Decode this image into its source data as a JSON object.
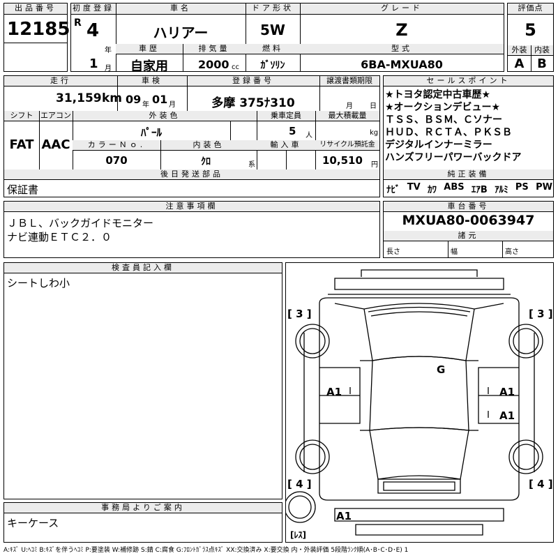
{
  "lot": {
    "header": "出品番号",
    "value": "12185"
  },
  "first_reg": {
    "header": "初度登録",
    "era": "R",
    "year": "4",
    "year_unit": "年",
    "month": "1",
    "month_unit": "月"
  },
  "car_name": {
    "header": "車名",
    "value": "ハリアー"
  },
  "door": {
    "header": "ドア形状",
    "value": "5W"
  },
  "grade": {
    "header": "グレード",
    "value": "Z"
  },
  "score": {
    "header": "評価点",
    "value": "5",
    "ext_header": "外装",
    "ext_value": "A",
    "int_header": "内装",
    "int_value": "B"
  },
  "history": {
    "header": "車歴",
    "value": "自家用"
  },
  "displacement": {
    "header": "排気量",
    "value": "2000",
    "unit": "cc"
  },
  "fuel": {
    "header": "燃料",
    "value": "ｶﾞｿﾘﾝ"
  },
  "model": {
    "header": "型式",
    "value": "6BA-MXUA80"
  },
  "mileage": {
    "header": "走行",
    "value": "31,159",
    "unit": "km"
  },
  "inspection": {
    "header": "車検",
    "year": "09",
    "year_unit": "年",
    "month": "01",
    "month_unit": "月"
  },
  "plate": {
    "header": "登録番号",
    "value": "多摩 375ﾅ310"
  },
  "transfer": {
    "header": "譲渡書類期限",
    "month_unit": "月",
    "day_unit": "日"
  },
  "shift": {
    "header": "シフト",
    "value": "FAT"
  },
  "aircon": {
    "header": "エアコン",
    "value": "AAC"
  },
  "exterior_color": {
    "header": "外装色",
    "value": "ﾊﾟｰﾙ"
  },
  "capacity": {
    "header": "乗車定員",
    "value": "5",
    "unit": "人"
  },
  "max_load": {
    "header": "最大積載量",
    "unit": "kg"
  },
  "color_no": {
    "header": "カラーＮｏ.",
    "value": "070"
  },
  "interior_color": {
    "header": "内装色",
    "value": "ｸﾛ",
    "unit": "系"
  },
  "import": {
    "header": "輸入車"
  },
  "recycle": {
    "header": "リサイクル預託金",
    "value": "10,510",
    "unit": "円"
  },
  "sales_points": {
    "header": "セールスポイント",
    "lines": [
      "★トヨタ認定中古車歴★",
      "★オークションデビュー★",
      "ＴＳＳ、ＢＳＭ、Ｃソナー",
      "ＨＵＤ、ＲＣＴＡ、ＰＫＳＢ",
      "デジタルインナーミラー",
      "ハンズフリーパワーバックドア"
    ]
  },
  "later_parts": {
    "header": "後日発送部品",
    "value": "保証書"
  },
  "equipment": {
    "header": "純正装備",
    "items": [
      "ﾅﾋﾞ",
      "TV",
      "ｶﾜ",
      "ABS",
      "ｴｱB",
      "ｱﾙﾐ",
      "PS",
      "PW"
    ]
  },
  "notes": {
    "header": "注意事項欄",
    "lines": [
      "ＪＢＬ、バックガイドモニター",
      "ナビ連動ＥＴＣ２．０"
    ]
  },
  "chassis": {
    "header": "車台番号",
    "value": "MXUA80-0063947"
  },
  "specs": {
    "header": "諸元",
    "length": "長さ",
    "width": "幅",
    "height": "高さ"
  },
  "inspector": {
    "header": "検査員記入欄",
    "value": "シートしわ小"
  },
  "office": {
    "header": "事務局よりご案内",
    "value": "キーケース"
  },
  "diagram": {
    "left_top": "[ 3 ]",
    "right_top": "[ 3 ]",
    "left_bottom": "[ 4 ]",
    "right_bottom": "[ 4 ]",
    "marks": {
      "roof": "G",
      "left_door": "A1",
      "right_front_door": "A1",
      "right_rear_door": "A1",
      "rear": "A1"
    },
    "les": "[ﾚｽ]"
  },
  "legend": "A:ｷｽﾞ U:ﾍｺﾐ B:ｷｽﾞを伴うﾍｺﾐ P:要塗装 W:補修跡 S:錆 C:腐食 G:ﾌﾛﾝﾄｶﾞﾗｽ点ｷｽﾞ XX:交換済み X:要交換 内・外装評価 5段階ﾗﾝｸ順(A･B･C･D･E) 1"
}
